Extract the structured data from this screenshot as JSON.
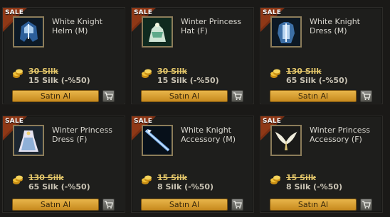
{
  "sale_label": "SALE",
  "buy_label": "Satın Al",
  "colors": {
    "sale_badge": "#7a2e12",
    "button": "#d9a035",
    "old_price": "#e3c66a"
  },
  "items": [
    {
      "name": "White Knight Helm (M)",
      "old_price": "30 Silk",
      "new_price": "15 Silk (-%50)",
      "icon": "helm-icon"
    },
    {
      "name": "Winter Princess Hat (F)",
      "old_price": "30 Silk",
      "new_price": "15 Silk (-%50)",
      "icon": "hat-icon"
    },
    {
      "name": "White Knight Dress (M)",
      "old_price": "130 Silk",
      "new_price": "65 Silk (-%50)",
      "icon": "armor-icon"
    },
    {
      "name": "Winter Princess Dress (F)",
      "old_price": "130 Silk",
      "new_price": "65 Silk (-%50)",
      "icon": "dress-icon"
    },
    {
      "name": "White Knight Accessory (M)",
      "old_price": "15 Silk",
      "new_price": "8 Silk (-%50)",
      "icon": "lance-icon"
    },
    {
      "name": "Winter Princess Accessory (F)",
      "old_price": "15 Silk",
      "new_price": "8 Silk (-%50)",
      "icon": "wings-icon"
    }
  ]
}
